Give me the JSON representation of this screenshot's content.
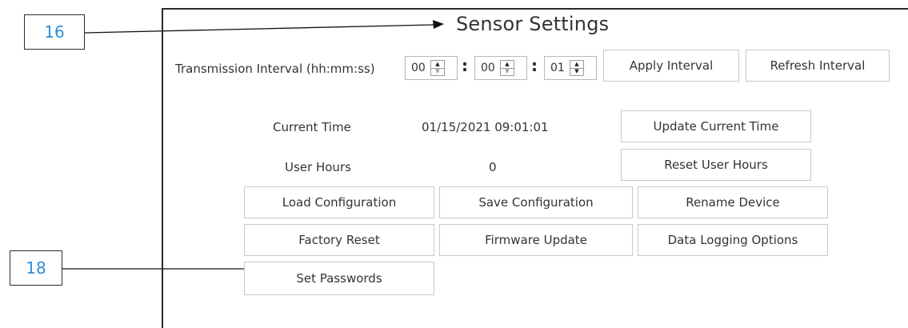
{
  "title": "Sensor Settings",
  "callouts": {
    "top": "16",
    "bottom": "18"
  },
  "interval": {
    "label": "Transmission Interval (hh:mm:ss)",
    "hours": "00",
    "minutes": "00",
    "seconds": "01",
    "separator": ":",
    "apply_label": "Apply Interval",
    "refresh_label": "Refresh Interval"
  },
  "current_time": {
    "label": "Current Time",
    "value": "01/15/2021 09:01:01",
    "button_label": "Update Current Time"
  },
  "user_hours": {
    "label": "User Hours",
    "value": "0",
    "button_label": "Reset User Hours"
  },
  "actions": {
    "load_configuration": "Load Configuration",
    "save_configuration": "Save Configuration",
    "rename_device": "Rename Device",
    "factory_reset": "Factory Reset",
    "firmware_update": "Firmware Update",
    "data_logging_options": "Data Logging Options",
    "set_passwords": "Set Passwords"
  },
  "colors": {
    "callout_text": "#2f8fd6",
    "border": "#c9c9c9",
    "frame": "#2a2a2a"
  }
}
